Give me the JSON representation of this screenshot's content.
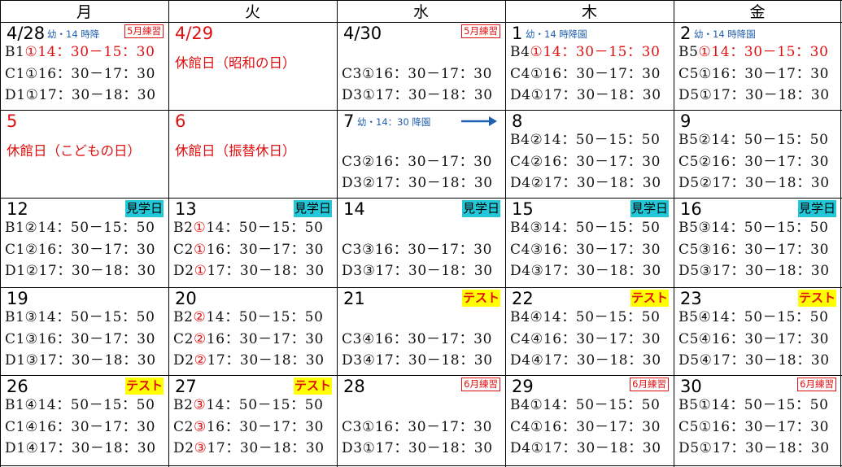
{
  "headers": [
    "月",
    "火",
    "水",
    "木",
    "金"
  ],
  "rows": [
    [
      {
        "num": "4/28",
        "note": "幼・14 時降",
        "badge": {
          "type": "ren",
          "text": "5月練習"
        },
        "lines": [
          {
            "cls": "B1",
            "circ": "①",
            "time": "14：30－15：30",
            "red_time": true
          },
          {
            "cls": "C1",
            "circ": "①",
            "time": "16：30－17：30"
          },
          {
            "cls": "D1",
            "circ": "①",
            "time": "17：30－18：30"
          }
        ]
      },
      {
        "num": "4/29",
        "num_red": true,
        "holiday": "休館日（昭和の日）"
      },
      {
        "num": "4/30",
        "badge": {
          "type": "ren",
          "text": "5月練習"
        },
        "lines": [
          null,
          {
            "cls": "C3",
            "circ": "①",
            "time": "16：30－17：30"
          },
          {
            "cls": "D3",
            "circ": "①",
            "time": "17：30－18：30"
          }
        ]
      },
      {
        "num": "1",
        "note": "幼・14 時降園",
        "lines": [
          {
            "cls": "B4",
            "circ": "①",
            "time": "14：30－15：30",
            "red_time": true
          },
          {
            "cls": "C4",
            "circ": "①",
            "time": "16：30－17：30"
          },
          {
            "cls": "D4",
            "circ": "①",
            "time": "17：30－18：30"
          }
        ]
      },
      {
        "num": "2",
        "note": "幼・14 時降園",
        "lines": [
          {
            "cls": "B5",
            "circ": "①",
            "time": "14：30－15：30",
            "red_time": true
          },
          {
            "cls": "C5",
            "circ": "①",
            "time": "16：30－17：30"
          },
          {
            "cls": "D5",
            "circ": "①",
            "time": "17：30－18：30"
          }
        ]
      }
    ],
    [
      {
        "num": "5",
        "num_red": true,
        "holiday": "休館日（こどもの日）"
      },
      {
        "num": "6",
        "num_red": true,
        "holiday": "休館日（振替休日）"
      },
      {
        "num": "7",
        "note": "幼・14：30 降園",
        "arrow": true,
        "lines": [
          null,
          {
            "cls": "C3",
            "circ": "②",
            "time": "16：30－17：30"
          },
          {
            "cls": "D3",
            "circ": "②",
            "time": "17：30－18：30"
          }
        ]
      },
      {
        "num": "8",
        "lines": [
          {
            "cls": "B4",
            "circ": "②",
            "time": "14：50－15：50"
          },
          {
            "cls": "C4",
            "circ": "②",
            "time": "16：30－17：30"
          },
          {
            "cls": "D4",
            "circ": "②",
            "time": "17：30－18：30"
          }
        ]
      },
      {
        "num": "9",
        "lines": [
          {
            "cls": "B5",
            "circ": "②",
            "time": "14：50－15：50"
          },
          {
            "cls": "C5",
            "circ": "②",
            "time": "16：30－17：30"
          },
          {
            "cls": "D5",
            "circ": "②",
            "time": "17：30－18：30"
          }
        ]
      }
    ],
    [
      {
        "num": "12",
        "badge": {
          "type": "ken",
          "text": "見学日"
        },
        "lines": [
          {
            "cls": "B1",
            "circ": "②",
            "time": "14：50－15：50"
          },
          {
            "cls": "C1",
            "circ": "②",
            "time": "16：30－17：30"
          },
          {
            "cls": "D1",
            "circ": "②",
            "time": "17：30－18：30"
          }
        ]
      },
      {
        "num": "13",
        "badge": {
          "type": "ken",
          "text": "見学日"
        },
        "lines": [
          {
            "cls": "B2",
            "circ": "①",
            "red_circ": true,
            "time": "14：50－15：50"
          },
          {
            "cls": "C2",
            "circ": "①",
            "red_circ": true,
            "time": "16：30－17：30"
          },
          {
            "cls": "D2",
            "circ": "①",
            "red_circ": true,
            "time": "17：30－18：30"
          }
        ]
      },
      {
        "num": "14",
        "badge": {
          "type": "ken",
          "text": "見学日"
        },
        "lines": [
          null,
          {
            "cls": "C3",
            "circ": "③",
            "time": "16：30－17：30"
          },
          {
            "cls": "D3",
            "circ": "③",
            "time": "17：30－18：30"
          }
        ]
      },
      {
        "num": "15",
        "badge": {
          "type": "ken",
          "text": "見学日"
        },
        "lines": [
          {
            "cls": "B4",
            "circ": "③",
            "time": "14：50－15：50"
          },
          {
            "cls": "C4",
            "circ": "③",
            "time": "16：30－17：30"
          },
          {
            "cls": "D4",
            "circ": "③",
            "time": "17：30－18：30"
          }
        ]
      },
      {
        "num": "16",
        "badge": {
          "type": "ken",
          "text": "見学日"
        },
        "lines": [
          {
            "cls": "B5",
            "circ": "③",
            "time": "14：50－15：50"
          },
          {
            "cls": "C5",
            "circ": "③",
            "time": "16：30－17：30"
          },
          {
            "cls": "D5",
            "circ": "③",
            "time": "17：30－18：30"
          }
        ]
      }
    ],
    [
      {
        "num": "19",
        "lines": [
          {
            "cls": "B1",
            "circ": "③",
            "time": "14：50－15：50"
          },
          {
            "cls": "C1",
            "circ": "③",
            "time": "16：30－17：30"
          },
          {
            "cls": "D1",
            "circ": "③",
            "time": "17：30－18：30"
          }
        ]
      },
      {
        "num": "20",
        "lines": [
          {
            "cls": "B2",
            "circ": "②",
            "red_circ": true,
            "time": "14：50－15：50"
          },
          {
            "cls": "C2",
            "circ": "②",
            "red_circ": true,
            "time": "16：30－17：30"
          },
          {
            "cls": "D2",
            "circ": "②",
            "red_circ": true,
            "time": "17：30－18：30"
          }
        ]
      },
      {
        "num": "21",
        "badge": {
          "type": "test",
          "text": "テスト"
        },
        "lines": [
          null,
          {
            "cls": "C3",
            "circ": "④",
            "time": "16：30－17：30"
          },
          {
            "cls": "D3",
            "circ": "④",
            "time": "17：30－18：30"
          }
        ]
      },
      {
        "num": "22",
        "badge": {
          "type": "test",
          "text": "テスト"
        },
        "lines": [
          {
            "cls": "B4",
            "circ": "④",
            "time": "14：50－15：50"
          },
          {
            "cls": "C4",
            "circ": "④",
            "time": "16：30－17：30"
          },
          {
            "cls": "D4",
            "circ": "④",
            "time": "17：30－18：30"
          }
        ]
      },
      {
        "num": "23",
        "badge": {
          "type": "test",
          "text": "テスト"
        },
        "lines": [
          {
            "cls": "B5",
            "circ": "④",
            "time": "14：50－15：50"
          },
          {
            "cls": "C5",
            "circ": "④",
            "time": "16：30－17：30"
          },
          {
            "cls": "D5",
            "circ": "④",
            "time": "17：30－18：30"
          }
        ]
      }
    ],
    [
      {
        "num": "26",
        "badge": {
          "type": "test",
          "text": "テスト"
        },
        "lines": [
          {
            "cls": "B1",
            "circ": "④",
            "time": "14：50－15：50"
          },
          {
            "cls": "C1",
            "circ": "④",
            "time": "16：30－17：30"
          },
          {
            "cls": "D1",
            "circ": "④",
            "time": "17：30－18：30"
          }
        ]
      },
      {
        "num": "27",
        "badge": {
          "type": "test",
          "text": "テスト"
        },
        "lines": [
          {
            "cls": "B2",
            "circ": "③",
            "red_circ": true,
            "time": "14：50－15：50"
          },
          {
            "cls": "C2",
            "circ": "③",
            "red_circ": true,
            "time": "16：30－17：30"
          },
          {
            "cls": "D2",
            "circ": "③",
            "red_circ": true,
            "time": "17：30－18：30"
          }
        ]
      },
      {
        "num": "28",
        "badge": {
          "type": "ren",
          "text": "6月練習"
        },
        "lines": [
          null,
          {
            "cls": "C3",
            "circ": "①",
            "time": "16：30－17：30"
          },
          {
            "cls": "D3",
            "circ": "①",
            "time": "17：30－18：30"
          }
        ]
      },
      {
        "num": "29",
        "badge": {
          "type": "ren",
          "text": "6月練習"
        },
        "lines": [
          {
            "cls": "B4",
            "circ": "①",
            "time": "14：50－15：50"
          },
          {
            "cls": "C4",
            "circ": "①",
            "time": "16：30－17：30"
          },
          {
            "cls": "D4",
            "circ": "①",
            "time": "17：30－18：30"
          }
        ]
      },
      {
        "num": "30",
        "badge": {
          "type": "ren",
          "text": "6月練習"
        },
        "lines": [
          {
            "cls": "B5",
            "circ": "①",
            "time": "14：50－15：50"
          },
          {
            "cls": "C5",
            "circ": "①",
            "time": "16：30－17：30"
          },
          {
            "cls": "D5",
            "circ": "①",
            "time": "17：30－18：30"
          }
        ]
      }
    ]
  ],
  "colors": {
    "red": "#e01010",
    "note_blue": "#2060b0",
    "badge_cyan": "#22c8d8",
    "badge_yellow": "#ffff00"
  }
}
